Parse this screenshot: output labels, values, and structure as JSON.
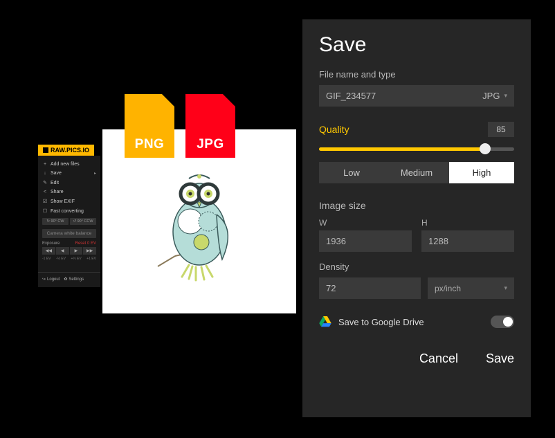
{
  "brand": {
    "name": "RAW.PICS.IO"
  },
  "toolbar": {
    "addNew": "Add new files",
    "save": "Save",
    "edit": "Edit",
    "share": "Share",
    "showExif": "Show EXIF",
    "fastConv": "Fast converting",
    "rotCw": "↻ 90° CW",
    "rotCcw": "↺ 90° CCW",
    "camWB": "Camera white balance",
    "exposureLabel": "Exposure",
    "exposureReset": "Reset 0 EV",
    "steps": [
      "◀◀",
      "◀",
      "▶",
      "▶▶"
    ],
    "ticks": [
      "-1 EV",
      "-⅓ EV",
      "+⅓ EV",
      "+1 EV"
    ],
    "logout": "Logout",
    "settings": "Settings"
  },
  "fileBadges": {
    "png": "PNG",
    "jpg": "JPG"
  },
  "panel": {
    "title": "Save",
    "fileSectionLabel": "File name and type",
    "fileName": "GIF_234577",
    "fileType": "JPG",
    "qualityLabel": "Quality",
    "qualityValue": "85",
    "qualitySeg": {
      "low": "Low",
      "medium": "Medium",
      "high": "High"
    },
    "imageSizeLabel": "Image size",
    "wLabel": "W",
    "hLabel": "H",
    "width": "1936",
    "height": "1288",
    "densityLabel": "Density",
    "densityValue": "72",
    "densityUnit": "px/inch",
    "gdriveLabel": "Save to Google Drive",
    "cancel": "Cancel",
    "save": "Save"
  }
}
